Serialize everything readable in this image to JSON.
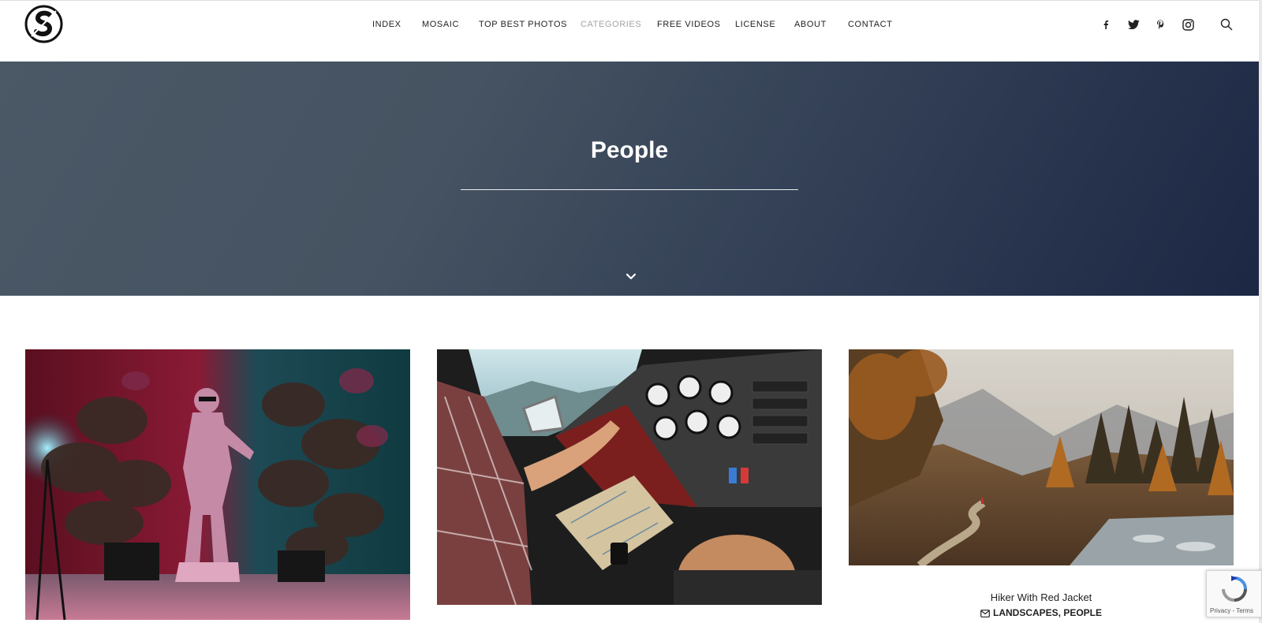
{
  "header": {
    "nav": [
      {
        "label": "INDEX",
        "active": false
      },
      {
        "label": "MOSAIC",
        "active": false
      },
      {
        "label": "TOP BEST PHOTOS",
        "active": false
      },
      {
        "label": "CATEGORIES",
        "active": true
      },
      {
        "label": "FREE VIDEOS",
        "active": false
      },
      {
        "label": "LICENSE",
        "active": false
      },
      {
        "label": "ABOUT",
        "active": false
      },
      {
        "label": "CONTACT",
        "active": false
      }
    ],
    "social_icons": [
      "facebook-icon",
      "twitter-icon",
      "pinterest-icon",
      "instagram-icon"
    ],
    "search_icon": "search-icon"
  },
  "hero": {
    "title": "People",
    "scroll_icon": "chevron-down-icon"
  },
  "gallery": {
    "photos": [
      {
        "subject": "statue-neon-plants"
      },
      {
        "subject": "cockpit-pilot-map"
      },
      {
        "subject": "autumn-mountain-trail"
      }
    ],
    "third_caption": {
      "title": "Hiker With Red Jacket",
      "categories": "LANDSCAPES, PEOPLE"
    }
  },
  "recaptcha": {
    "legal": "Privacy - Terms"
  },
  "colors": {
    "nav_text": "#222222",
    "nav_active": "#a3a3a3",
    "hero_start": "#4b5866",
    "hero_end": "#1c2744"
  }
}
